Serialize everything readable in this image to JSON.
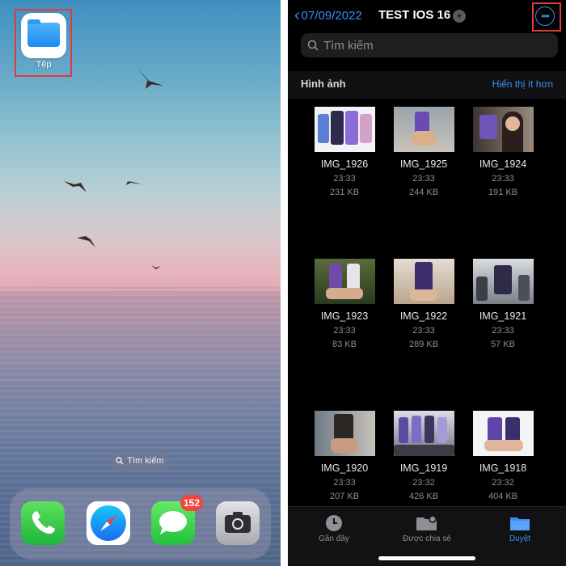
{
  "home": {
    "files_app_label": "Tệp",
    "spotlight_label": "Tìm kiếm",
    "messages_badge": "152"
  },
  "files": {
    "back_label": "07/09/2022",
    "title": "TEST IOS 16",
    "search_placeholder": "Tìm kiếm",
    "section_title": "Hình ảnh",
    "section_link": "Hiển thị ít hơn",
    "items": [
      {
        "name": "IMG_1926",
        "time": "23:33",
        "size": "231 KB"
      },
      {
        "name": "IMG_1925",
        "time": "23:33",
        "size": "244 KB"
      },
      {
        "name": "IMG_1924",
        "time": "23:33",
        "size": "191 KB"
      },
      {
        "name": "IMG_1923",
        "time": "23:33",
        "size": "83 KB"
      },
      {
        "name": "IMG_1922",
        "time": "23:33",
        "size": "289 KB"
      },
      {
        "name": "IMG_1921",
        "time": "23:33",
        "size": "57 KB"
      },
      {
        "name": "IMG_1920",
        "time": "23:33",
        "size": "207 KB"
      },
      {
        "name": "IMG_1919",
        "time": "23:32",
        "size": "426 KB"
      },
      {
        "name": "IMG_1918",
        "time": "23:32",
        "size": "404 KB"
      }
    ],
    "tabs": [
      {
        "label": "Gần đây",
        "icon": "clock-icon"
      },
      {
        "label": "Được chia sẻ",
        "icon": "shared-folder-icon"
      },
      {
        "label": "Duyệt",
        "icon": "folder-icon"
      }
    ]
  },
  "colors": {
    "accent": "#3b8ef6",
    "highlight": "#e03b3b",
    "badge": "#f4453b"
  }
}
